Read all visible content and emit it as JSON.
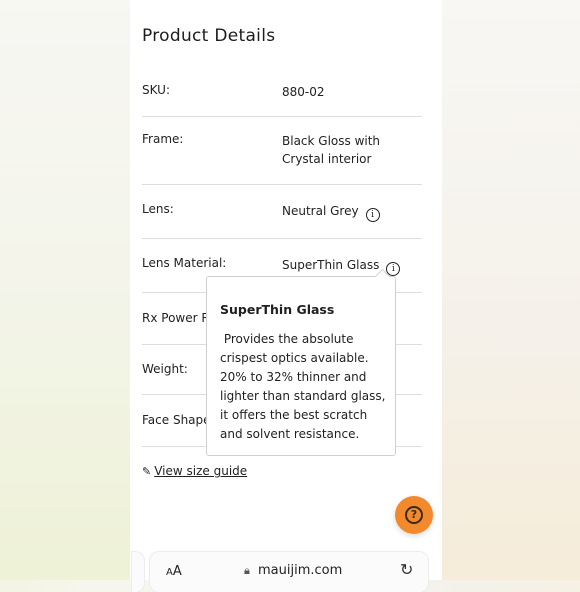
{
  "section": {
    "title": "Product Details"
  },
  "details": [
    {
      "label": "SKU:",
      "value": "880-02"
    },
    {
      "label": "Frame:",
      "value": "Black Gloss with Crystal interior"
    },
    {
      "label": "Lens:",
      "value": "Neutral Grey",
      "info_icon": "info-icon"
    },
    {
      "label": "Lens Material:",
      "value": "SuperThin Glass",
      "info_icon": "info-icon"
    },
    {
      "label": "Rx Power Ra",
      "value": ""
    },
    {
      "label": "Weight:",
      "value": ""
    },
    {
      "label": "Face Shape:",
      "value": ""
    }
  ],
  "tooltip": {
    "title": "SuperThin Glass",
    "body": " Provides the absolute crispest optics available. 20% to 32% thinner and lighter than standard glass, it offers the best scratch and solvent resistance."
  },
  "size_guide": {
    "icon": "pencil-icon",
    "label": "View size guide"
  },
  "help_button": {
    "icon": "question-icon",
    "color": "#f2892d"
  },
  "browser": {
    "aa_label": "AA",
    "domain": "mauijim.com",
    "lock_icon": "lock-icon",
    "reload_icon": "reload-icon"
  }
}
